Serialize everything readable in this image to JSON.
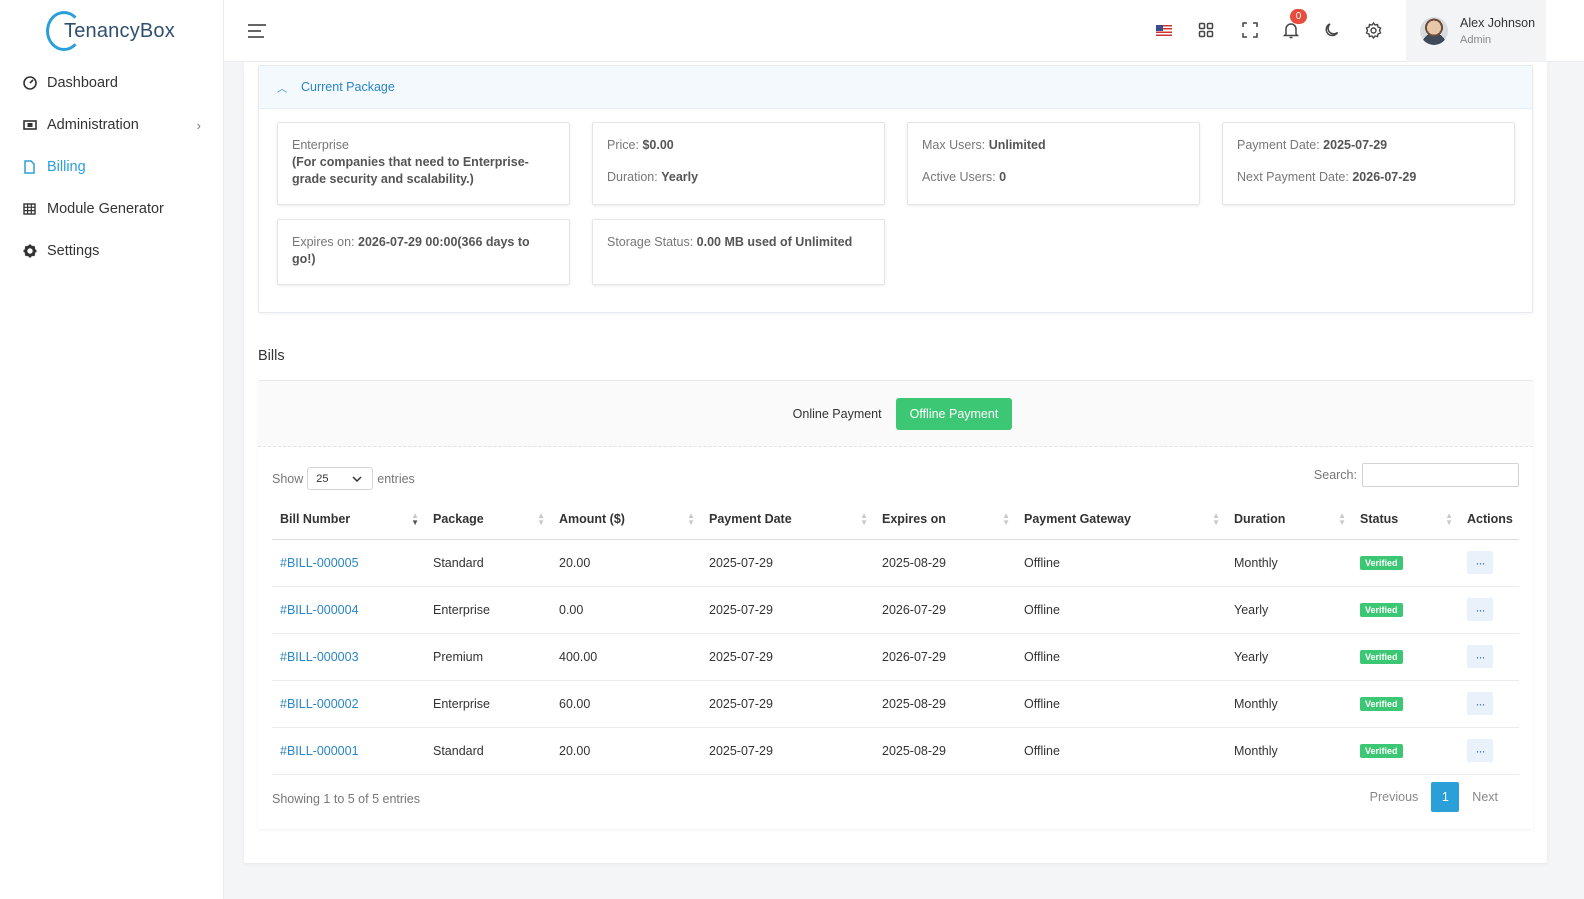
{
  "app": {
    "brand": "TenancyBox"
  },
  "sidebar": {
    "items": [
      {
        "label": "Dashboard",
        "icon": "dashboard-icon"
      },
      {
        "label": "Administration",
        "icon": "administration-icon"
      },
      {
        "label": "Billing",
        "icon": "file-icon",
        "active": true
      },
      {
        "label": "Module Generator",
        "icon": "grid-icon"
      },
      {
        "label": "Settings",
        "icon": "gear-icon"
      }
    ]
  },
  "topbar": {
    "notifications_count": "0",
    "user": {
      "name": "Alex Johnson",
      "role": "Admin"
    }
  },
  "package": {
    "header": "Current Package",
    "name": "Enterprise",
    "description": "(For companies that need to Enterprise-grade security and scalability.)",
    "price_label": "Price:",
    "price": "$0.00",
    "duration_label": "Duration:",
    "duration": "Yearly",
    "max_users_label": "Max Users:",
    "max_users": "Unlimited",
    "active_users_label": "Active Users:",
    "active_users": "0",
    "payment_date_label": "Payment Date:",
    "payment_date": "2025-07-29",
    "next_payment_label": "Next Payment Date:",
    "next_payment": "2026-07-29",
    "expires_label": "Expires on:",
    "expires": "2026-07-29 00:00(366 days to go!)",
    "storage_label": "Storage Status:",
    "storage": "0.00 MB used of Unlimited"
  },
  "bills": {
    "title": "Bills",
    "tabs": [
      {
        "label": "Online Payment"
      },
      {
        "label": "Offline Payment",
        "active": true
      }
    ],
    "show_label": "Show",
    "entries_value": "25",
    "entries_label": "entries",
    "search_label": "Search:",
    "columns": [
      "Bill Number",
      "Package",
      "Amount ($)",
      "Payment Date",
      "Expires on",
      "Payment Gateway",
      "Duration",
      "Status",
      "Actions"
    ],
    "rows": [
      {
        "bill": "#BILL-000005",
        "package": "Standard",
        "amount": "20.00",
        "payment_date": "2025-07-29",
        "expires": "2025-08-29",
        "gateway": "Offline",
        "duration": "Monthly",
        "status": "Verified"
      },
      {
        "bill": "#BILL-000004",
        "package": "Enterprise",
        "amount": "0.00",
        "payment_date": "2025-07-29",
        "expires": "2026-07-29",
        "gateway": "Offline",
        "duration": "Yearly",
        "status": "Verified"
      },
      {
        "bill": "#BILL-000003",
        "package": "Premium",
        "amount": "400.00",
        "payment_date": "2025-07-29",
        "expires": "2026-07-29",
        "gateway": "Offline",
        "duration": "Yearly",
        "status": "Verified"
      },
      {
        "bill": "#BILL-000002",
        "package": "Enterprise",
        "amount": "60.00",
        "payment_date": "2025-07-29",
        "expires": "2025-08-29",
        "gateway": "Offline",
        "duration": "Monthly",
        "status": "Verified"
      },
      {
        "bill": "#BILL-000001",
        "package": "Standard",
        "amount": "20.00",
        "payment_date": "2025-07-29",
        "expires": "2025-08-29",
        "gateway": "Offline",
        "duration": "Monthly",
        "status": "Verified"
      }
    ],
    "actions_label": "···",
    "footer": "Showing 1 to 5 of 5 entries",
    "pager": {
      "previous": "Previous",
      "current": "1",
      "next": "Next"
    }
  },
  "colors": {
    "accent": "#2a9fd8",
    "success": "#3cc774",
    "badge": "#e74c3c"
  }
}
